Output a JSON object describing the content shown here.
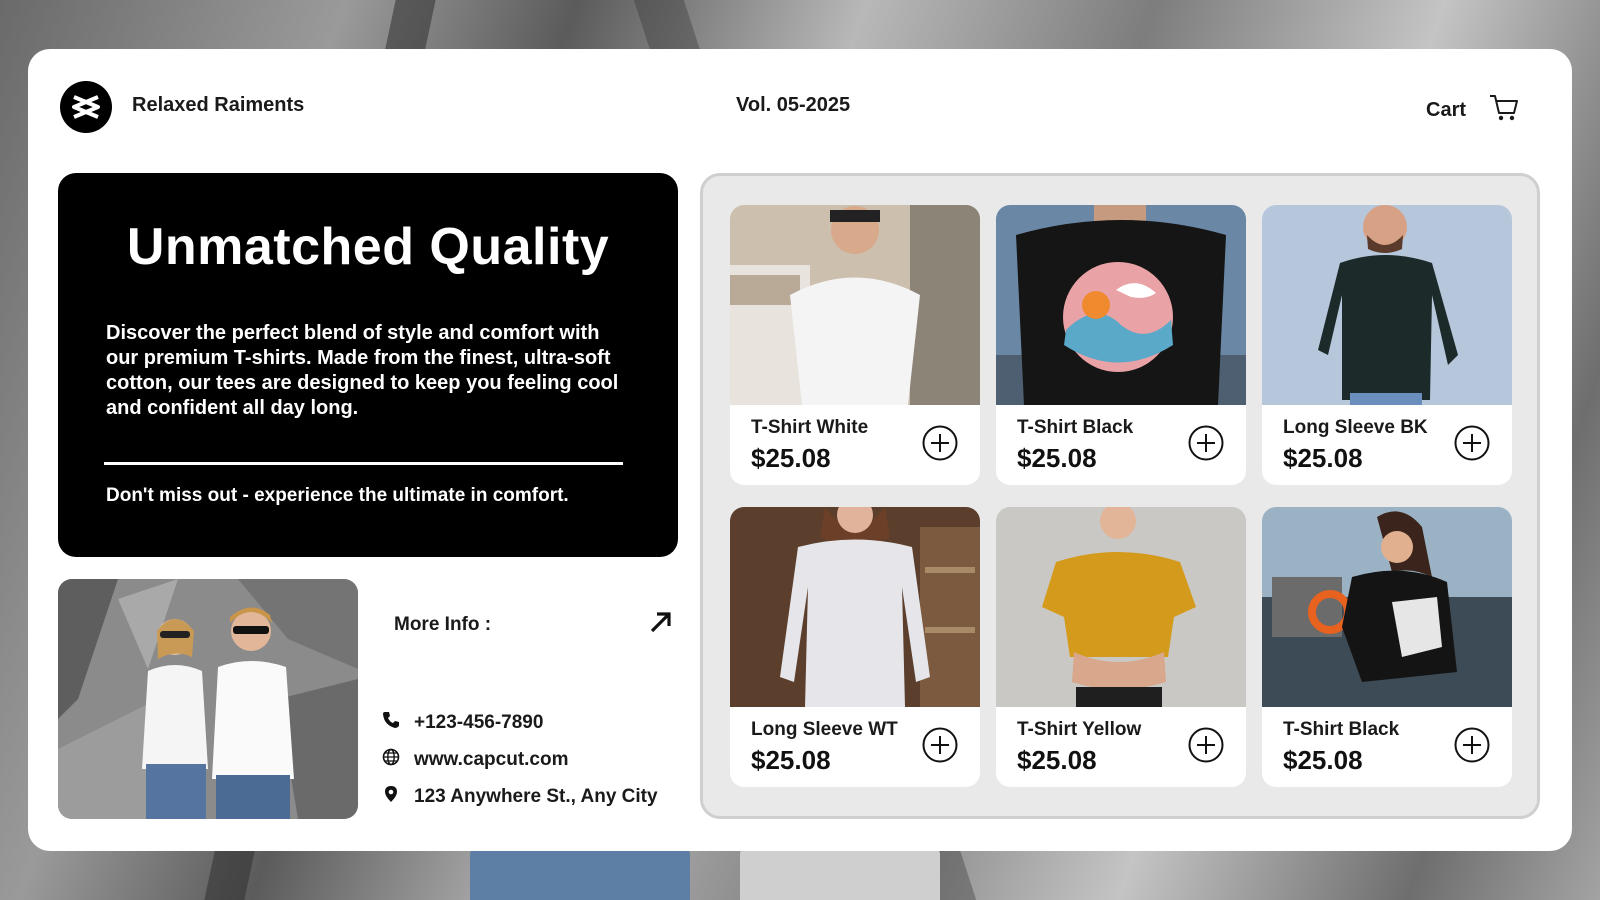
{
  "header": {
    "brand": "Relaxed Raiments",
    "issue": "Vol. 05-2025",
    "cart_label": "Cart",
    "logo_icon": "capcut-logo-icon",
    "cart_icon": "cart-icon"
  },
  "hero": {
    "title": "Unmatched Quality",
    "text": "Discover the perfect blend of style and comfort with our premium T-shirts. Made from the finest, ultra-soft cotton, our tees are designed to keep you feeling cool and confident all day long.",
    "tagline": "Don't miss out - experience the ultimate in comfort."
  },
  "info": {
    "more_label": "More Info :",
    "more_icon": "arrow-up-right-icon",
    "phone": "+123-456-7890",
    "website": "www.capcut.com",
    "address": "123 Anywhere St., Any City"
  },
  "products": [
    {
      "name": "T-Shirt White",
      "price": "$25.08"
    },
    {
      "name": "T-Shirt Black",
      "price": "$25.08"
    },
    {
      "name": "Long Sleeve BK",
      "price": "$25.08"
    },
    {
      "name": "Long Sleeve WT",
      "price": "$25.08"
    },
    {
      "name": "T-Shirt Yellow",
      "price": "$25.08"
    },
    {
      "name": "T-Shirt Black",
      "price": "$25.08"
    }
  ],
  "colors": {
    "accent": "#000000",
    "panel": "#e9e9e9",
    "card": "#ffffff"
  }
}
